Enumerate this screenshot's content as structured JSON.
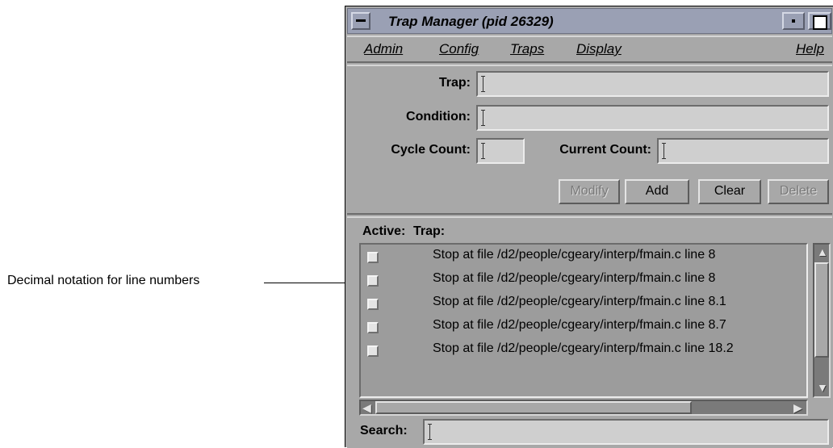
{
  "annotation": {
    "label": "Decimal notation for line numbers"
  },
  "window": {
    "title": "Trap Manager (pid 26329)",
    "menu": [
      "Admin",
      "Config",
      "Traps",
      "Display",
      "Help"
    ]
  },
  "form": {
    "trap_label": "Trap:",
    "trap_value": "",
    "condition_label": "Condition:",
    "condition_value": "",
    "cycle_count_label": "Cycle Count:",
    "cycle_count_value": "",
    "current_count_label": "Current Count:",
    "current_count_value": "",
    "buttons": {
      "modify": "Modify",
      "add": "Add",
      "clear": "Clear",
      "delete": "Delete"
    }
  },
  "list": {
    "active_header": "Active:",
    "trap_header": "Trap:",
    "rows": [
      {
        "active": false,
        "text": "Stop at file /d2/people/cgeary/interp/fmain.c line 8"
      },
      {
        "active": false,
        "text": "Stop at file /d2/people/cgeary/interp/fmain.c line 8"
      },
      {
        "active": false,
        "text": "Stop at file /d2/people/cgeary/interp/fmain.c line 8.1"
      },
      {
        "active": false,
        "text": "Stop at file /d2/people/cgeary/interp/fmain.c line 8.7"
      },
      {
        "active": false,
        "text": "Stop at file /d2/people/cgeary/interp/fmain.c line 18.2"
      }
    ]
  },
  "search": {
    "label": "Search:",
    "value": ""
  }
}
